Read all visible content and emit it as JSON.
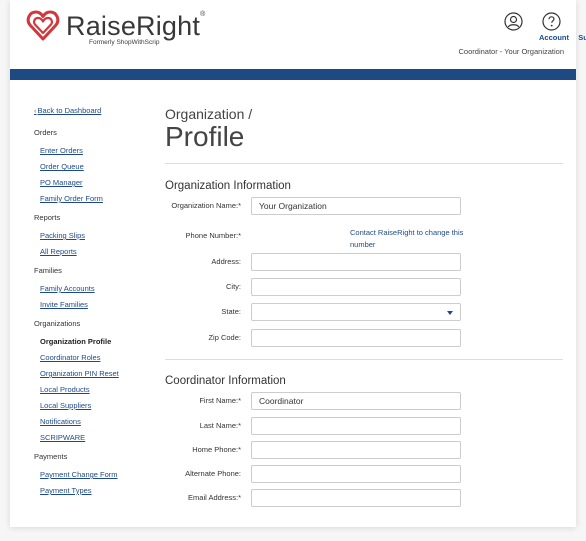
{
  "header": {
    "brand": "RaiseRight",
    "trademark": "®",
    "brand_sub": "Formerly ShopWithScrip",
    "account_label": "Account",
    "support_label": "Support",
    "role_text": "Coordinator - Your Organization",
    "brand_color": "#1e4a84",
    "accent_color": "#d2373c"
  },
  "sidebar": {
    "back": "Back to Dashboard",
    "back_icon": "chevron-left-icon",
    "sections": [
      {
        "title": "Orders",
        "items": [
          "Enter Orders",
          "Order Queue",
          "PO Manager",
          "Family Order Form"
        ]
      },
      {
        "title": "Reports",
        "items": [
          "Packing Slips",
          "All Reports"
        ]
      },
      {
        "title": "Families",
        "items": [
          "Family Accounts",
          "Invite Families"
        ]
      },
      {
        "title": "Organizations",
        "items": [
          "Organization Profile",
          "Coordinator Roles",
          "Organization PIN Reset",
          "Local Products",
          "Local Suppliers",
          "Notifications",
          "SCRIPWARE"
        ]
      },
      {
        "title": "Payments",
        "items": [
          "Payment Change Form",
          "Payment Types"
        ]
      }
    ],
    "active_item": "Organization Profile"
  },
  "main": {
    "breadcrumb": "Organization /",
    "title": "Profile",
    "org_section": {
      "title": "Organization Information",
      "org_name_label": "Organization Name:*",
      "org_name_value": "Your Organization",
      "phone_label": "Phone Number:*",
      "phone_note": "Contact RaiseRight to change this number",
      "address_label": "Address:",
      "address_value": "",
      "city_label": "City:",
      "city_value": "",
      "state_label": "State:",
      "state_value": "",
      "zip_label": "Zip Code:",
      "zip_value": ""
    },
    "coord_section": {
      "title": "Coordinator Information",
      "first_label": "First Name:*",
      "first_value": "Coordinator",
      "last_label": "Last Name:*",
      "last_value": "",
      "home_label": "Home Phone:*",
      "home_value": "",
      "alt_label": "Alternate Phone:",
      "alt_value": "",
      "email_label": "Email Address:*",
      "email_value": ""
    }
  }
}
